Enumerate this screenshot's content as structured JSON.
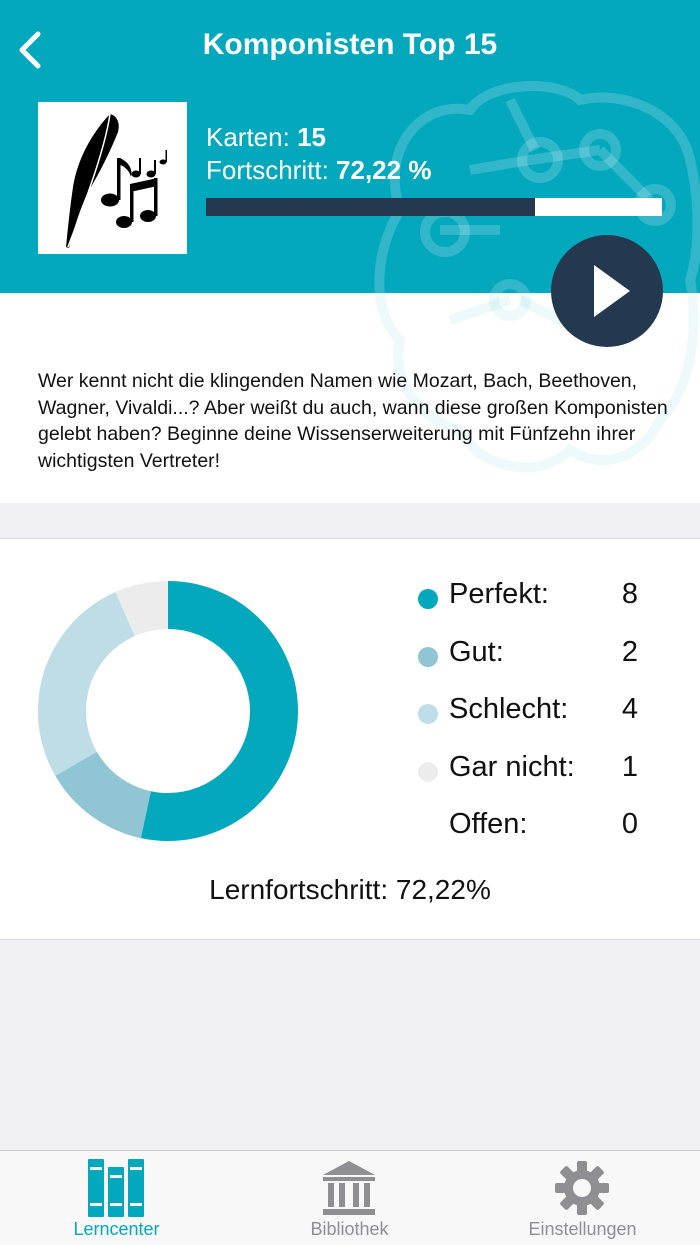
{
  "header": {
    "title": "Komponisten Top 15",
    "back_icon": "chevron-left-icon",
    "karten_label": "Karten:",
    "karten_value": "15",
    "fortschritt_label": "Fortschritt:",
    "fortschritt_value": "72,22 %",
    "progress_fraction": 0.7222,
    "play_icon": "play-icon"
  },
  "description": "Wer kennt nicht die klingenden Namen wie Mozart, Bach, Beethoven, Wagner, Vivaldi...? Aber weißt du auch, wann diese großen Komponisten gelebt haben? Beginne deine Wissenserweiterung mit Fünfzehn ihrer wichtigsten Vertreter!",
  "stats": {
    "legend": [
      {
        "label": "Perfekt:",
        "value": "8",
        "color": "#04a8bd"
      },
      {
        "label": "Gut:",
        "value": "2",
        "color": "#90c5d3"
      },
      {
        "label": "Schlecht:",
        "value": "4",
        "color": "#bedde6"
      },
      {
        "label": "Gar nicht:",
        "value": "1",
        "color": "#ececec"
      },
      {
        "label": "Offen:",
        "value": "0",
        "color": ""
      }
    ],
    "lernfortschritt": "Lernfortschritt: 72,22%"
  },
  "chart_data": {
    "type": "pie",
    "categories": [
      "Perfekt",
      "Gut",
      "Schlecht",
      "Gar nicht",
      "Offen"
    ],
    "values": [
      8,
      2,
      4,
      1,
      0
    ],
    "colors": [
      "#04a8bd",
      "#90c5d3",
      "#bedde6",
      "#ececec",
      "#ffffff"
    ],
    "title": "",
    "donut": true
  },
  "colors": {
    "accent": "#04a8bd",
    "dark": "#243850",
    "tab_inactive": "#8e8e93"
  },
  "tabbar": [
    {
      "label": "Lerncenter",
      "icon": "books-icon",
      "active": true
    },
    {
      "label": "Bibliothek",
      "icon": "library-icon",
      "active": false
    },
    {
      "label": "Einstellungen",
      "icon": "gear-icon",
      "active": false
    }
  ]
}
